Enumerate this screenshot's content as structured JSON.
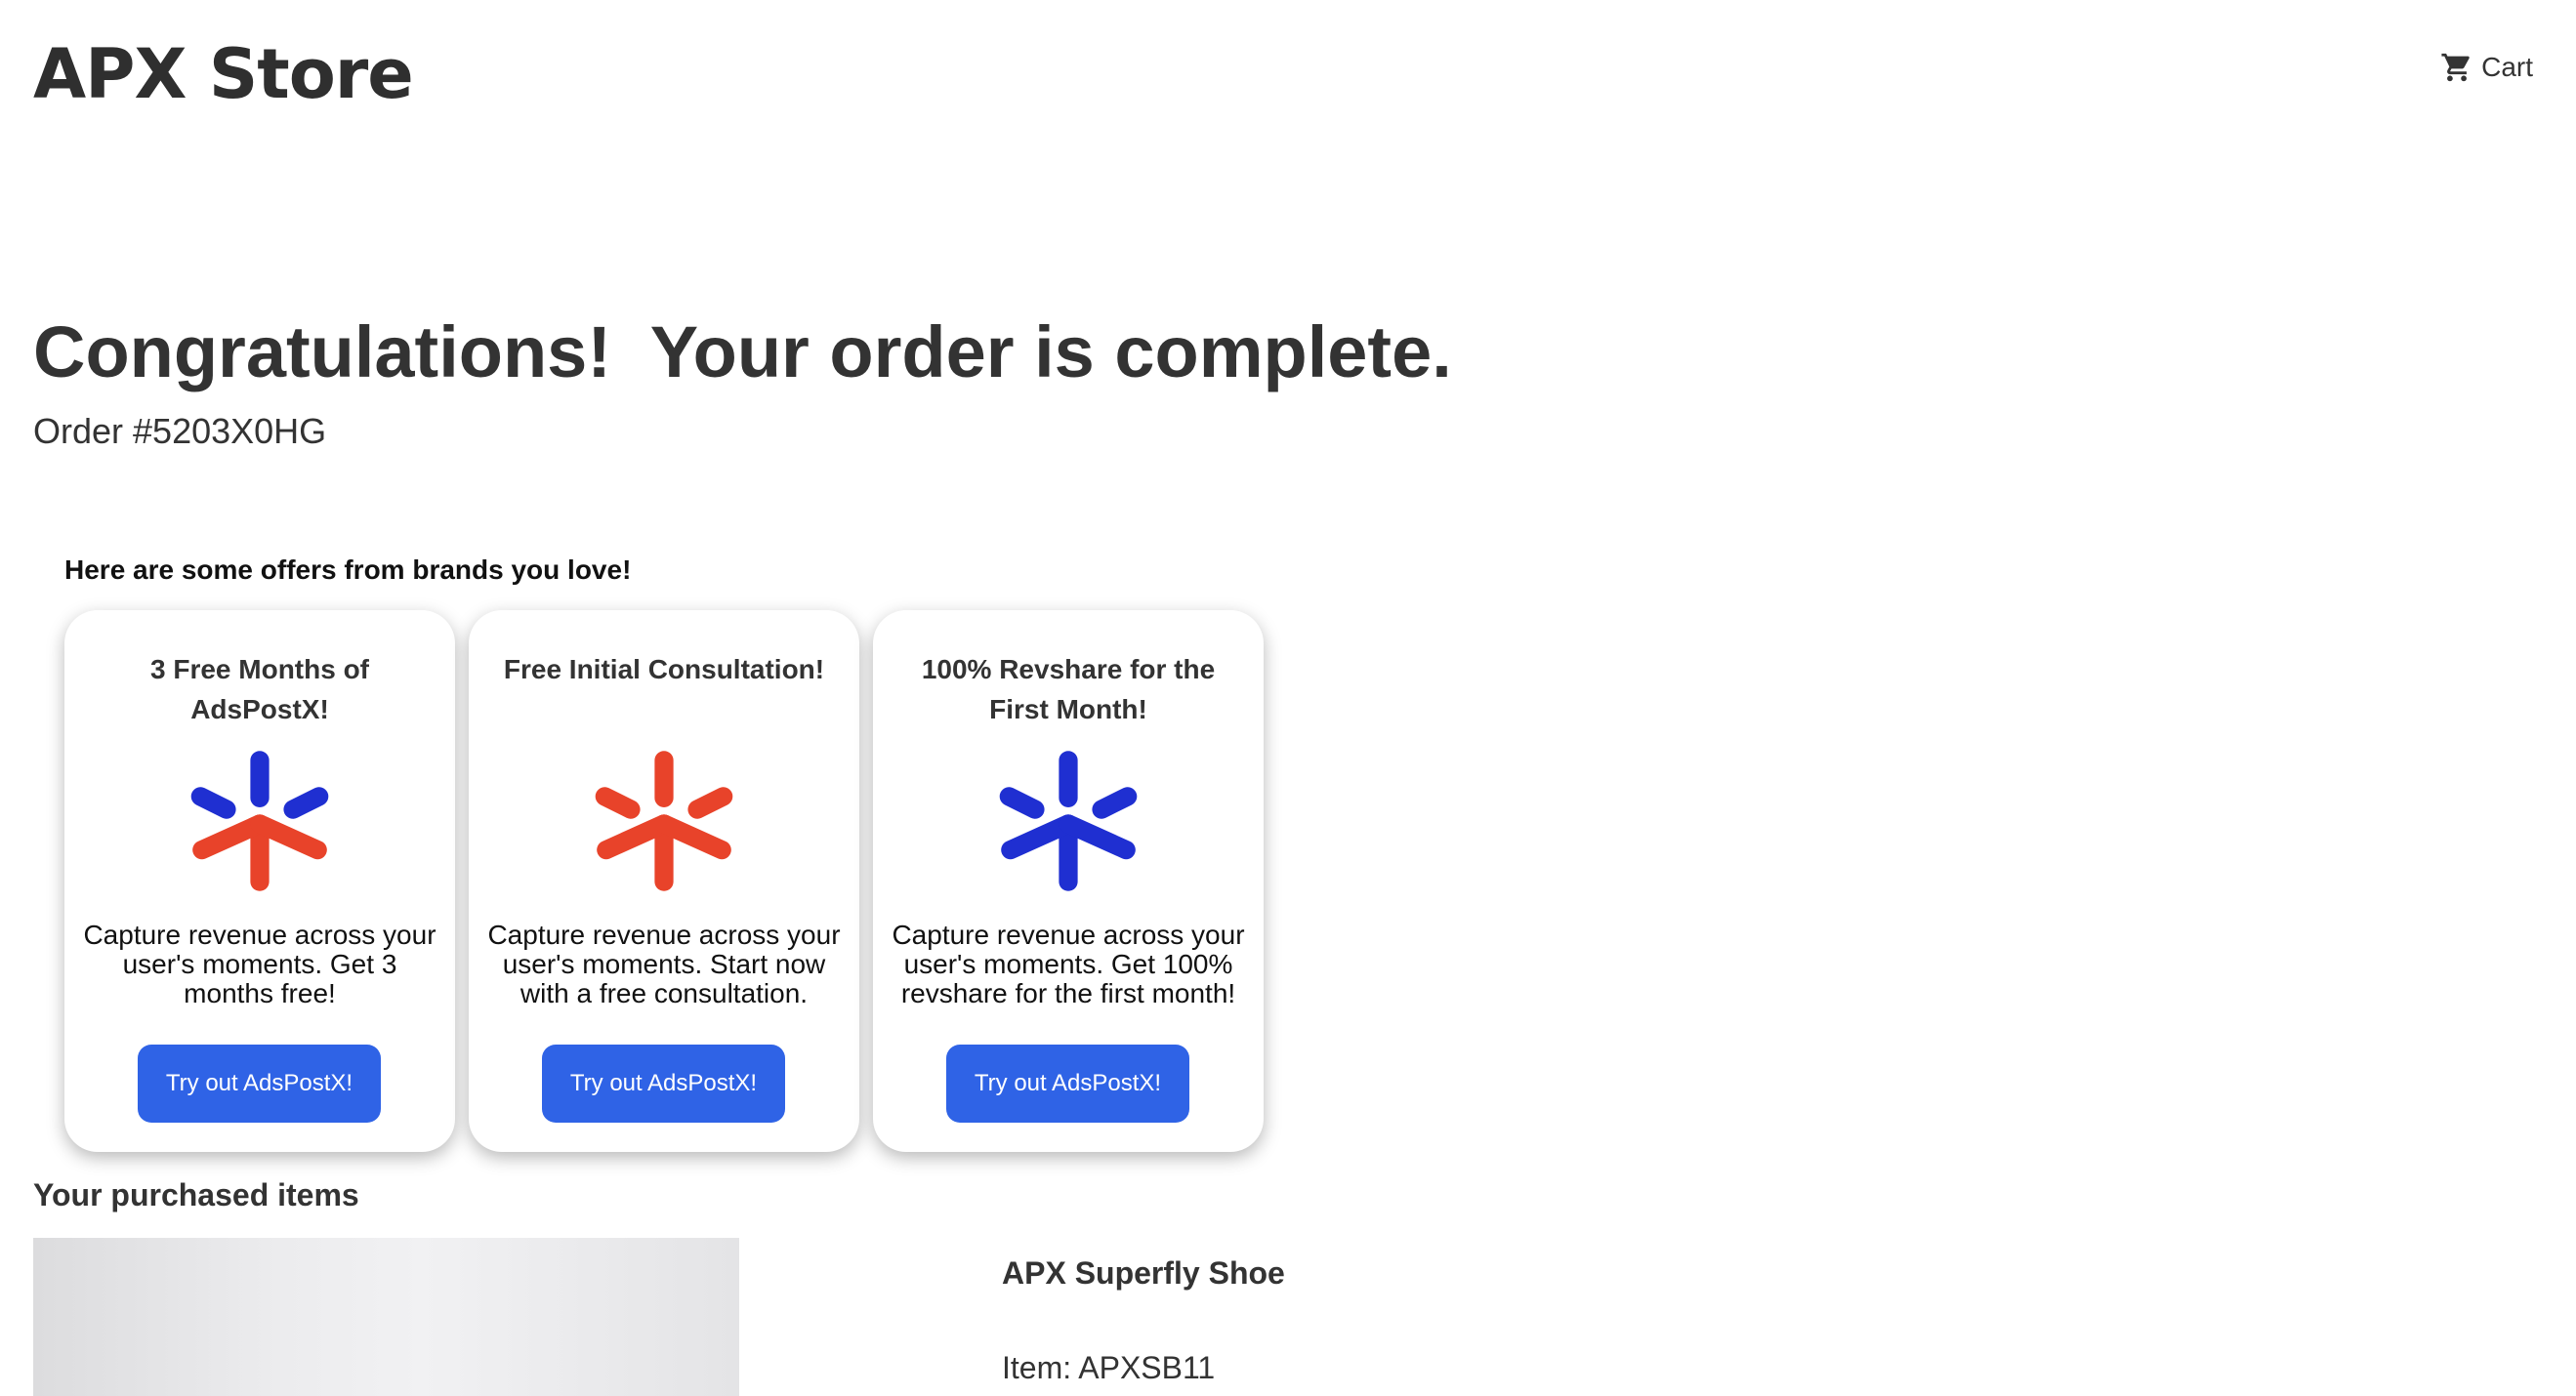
{
  "header": {
    "brand": "APX Store",
    "cart_label": "Cart",
    "cart_icon": "shopping-cart-icon"
  },
  "confirmation": {
    "heading": "Congratulations!  Your order is complete.",
    "order_number": "Order #5203X0HG"
  },
  "offers": {
    "heading": "Here are some offers from brands you love!",
    "cards": [
      {
        "title": "3 Free Months of AdsPostX!",
        "description": "Capture revenue across your user's moments. Get 3 months free!",
        "button_label": "Try out AdsPostX!",
        "logo_icon": "adspostx-logo-icon",
        "logo_top_color": "#1f2fd1",
        "logo_bottom_color": "#e8432a"
      },
      {
        "title": "Free Initial Consultation!",
        "description": "Capture revenue across your user's moments. Start now with a free consultation.",
        "button_label": "Try out AdsPostX!",
        "logo_icon": "adspostx-logo-icon",
        "logo_top_color": "#e8432a",
        "logo_bottom_color": "#e8432a"
      },
      {
        "title": "100% Revshare for the First Month!",
        "description": "Capture revenue across your user's moments. Get 100% revshare for the first month!",
        "button_label": "Try out AdsPostX!",
        "logo_icon": "adspostx-logo-icon",
        "logo_top_color": "#1f2fd1",
        "logo_bottom_color": "#1f2fd1"
      }
    ],
    "button_color": "#2f63e6"
  },
  "purchased": {
    "heading": "Your purchased items",
    "items": [
      {
        "name": "APX Superfly Shoe",
        "item_code": "Item: APXSB11"
      }
    ]
  }
}
